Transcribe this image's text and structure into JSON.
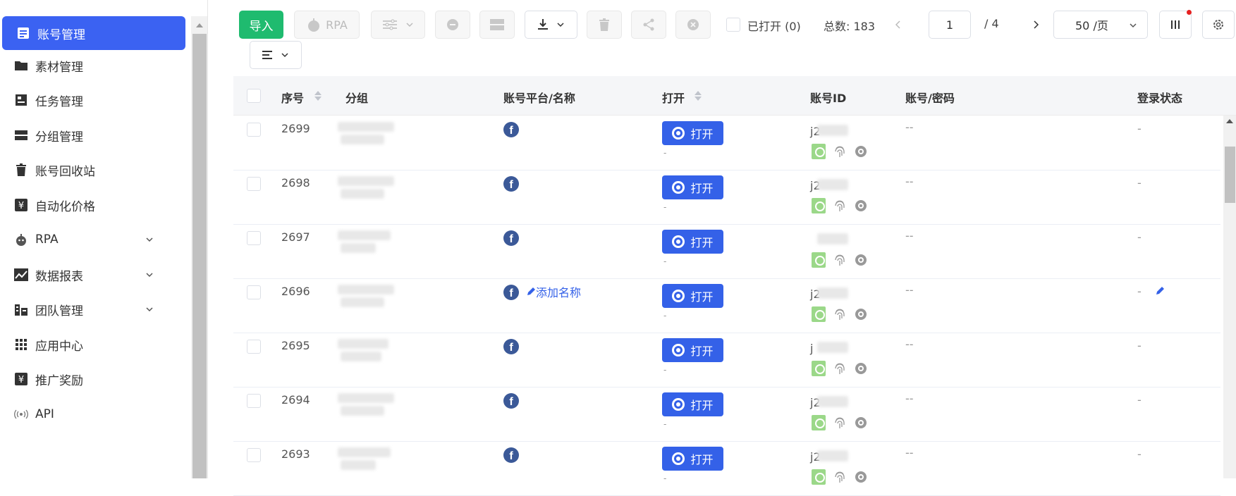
{
  "sidebar": {
    "items": [
      {
        "label": "账号管理",
        "icon": "account-icon",
        "active": true
      },
      {
        "label": "素材管理",
        "icon": "folder-icon"
      },
      {
        "label": "任务管理",
        "icon": "task-icon"
      },
      {
        "label": "分组管理",
        "icon": "group-icon"
      },
      {
        "label": "账号回收站",
        "icon": "trash-icon"
      },
      {
        "label": "自动化价格",
        "icon": "yen-icon"
      },
      {
        "label": "RPA",
        "icon": "robot-icon",
        "expandable": true
      },
      {
        "label": "数据报表",
        "icon": "chart-icon",
        "expandable": true
      },
      {
        "label": "团队管理",
        "icon": "team-icon",
        "expandable": true
      },
      {
        "label": "应用中心",
        "icon": "grid-icon"
      },
      {
        "label": "推广奖励",
        "icon": "yen-icon"
      },
      {
        "label": "API",
        "icon": "api-icon"
      }
    ]
  },
  "toolbar": {
    "import_label": "导入",
    "rpa_label": "RPA",
    "opened_label": "已打开 (0)",
    "total_label": "总数: 183",
    "page_current": "1",
    "page_total": "/ 4",
    "page_size": "50 /页"
  },
  "table": {
    "columns": [
      "序号",
      "分组",
      "账号平台/名称",
      "打开",
      "账号ID",
      "账号/密码",
      "登录状态"
    ],
    "open_label": "打开",
    "add_name_label": "添加名称",
    "rows": [
      {
        "no": "2699",
        "id": "j2",
        "password": "--",
        "status": "-",
        "open_sub": "-"
      },
      {
        "no": "2698",
        "id": "j2",
        "password": "--",
        "status": "-",
        "open_sub": "-"
      },
      {
        "no": "2697",
        "id": "",
        "password": "--",
        "status": "-",
        "open_sub": "-"
      },
      {
        "no": "2696",
        "id": "j2",
        "password": "--",
        "status": "-",
        "open_sub": "-",
        "add_name": true,
        "editable_status": true
      },
      {
        "no": "2695",
        "id": "j",
        "password": "--",
        "status": "-",
        "open_sub": "-"
      },
      {
        "no": "2694",
        "id": "j2",
        "password": "--",
        "status": "-",
        "open_sub": "-"
      },
      {
        "no": "2693",
        "id": "j2",
        "password": "--",
        "status": "-",
        "open_sub": "-"
      }
    ]
  },
  "colors": {
    "accent": "#3b62f2",
    "import": "#1fbb6f",
    "facebook": "#3b5998",
    "open_button": "#3461e8"
  }
}
